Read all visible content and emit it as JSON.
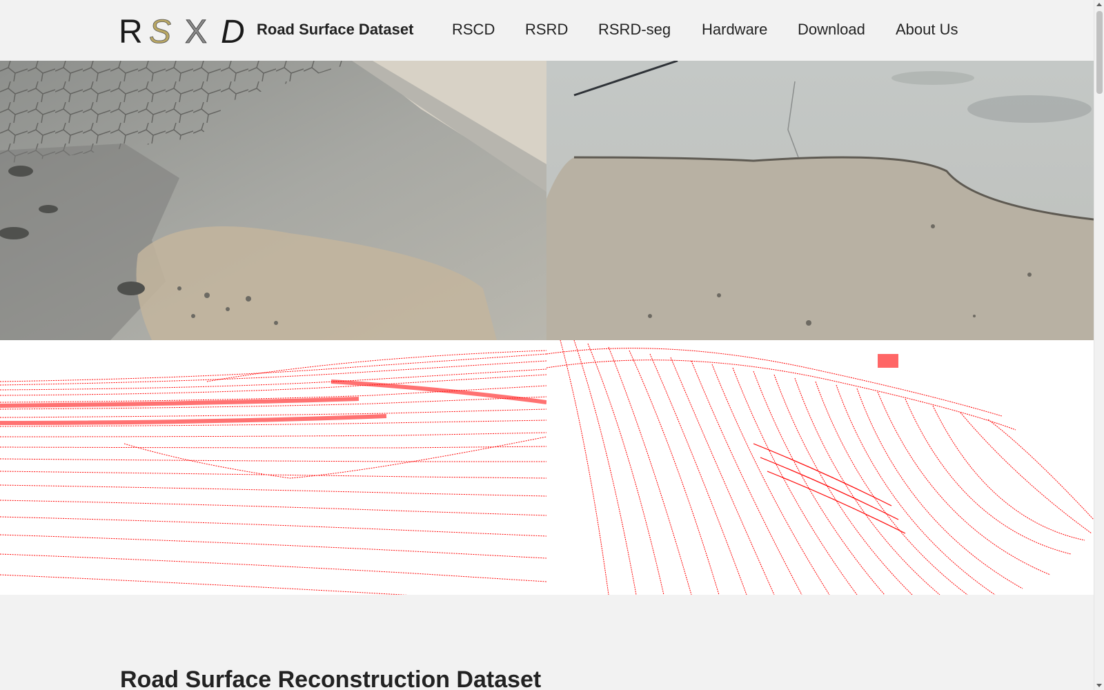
{
  "logo": {
    "letters": [
      "R",
      "S",
      "X",
      "D"
    ],
    "colors": {
      "dark": "#1a1a1a",
      "gold": "#b9a764",
      "gray": "#8a8a8a"
    }
  },
  "brand": {
    "title": "Road Surface Dataset"
  },
  "nav": {
    "items": [
      "RSCD",
      "RSRD",
      "RSRD-seg",
      "Hardware",
      "Download",
      "About Us"
    ]
  },
  "hero": {
    "images": [
      {
        "name": "cracked-asphalt-pothole-photo"
      },
      {
        "name": "concrete-pothole-photo"
      },
      {
        "name": "point-cloud-left"
      },
      {
        "name": "point-cloud-right"
      }
    ],
    "point_cloud_color": "#ff0000"
  },
  "section": {
    "title": "Road Surface Reconstruction Dataset"
  }
}
